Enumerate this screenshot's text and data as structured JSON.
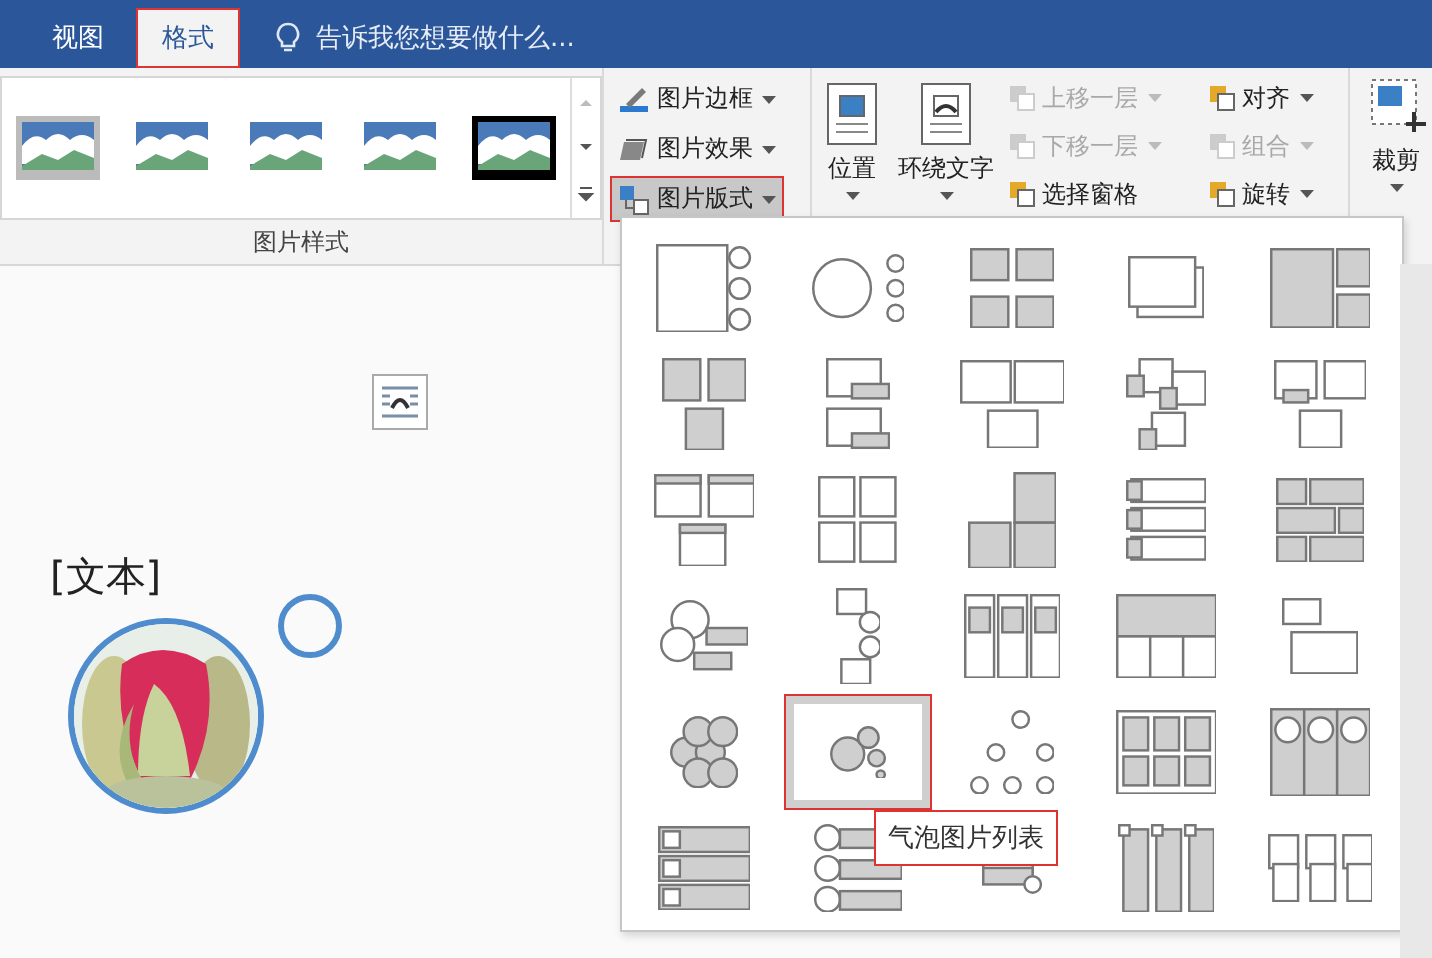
{
  "tabs": [
    {
      "label": "视图",
      "selected": false
    },
    {
      "label": "格式",
      "selected": true
    }
  ],
  "tell_me": {
    "placeholder": "告诉我您想要做什么..."
  },
  "picture_styles": {
    "label": "图片样式"
  },
  "picture_commands": [
    {
      "label": "图片边框",
      "pressed": false
    },
    {
      "label": "图片效果",
      "pressed": false
    },
    {
      "label": "图片版式",
      "pressed": true
    }
  ],
  "arrange": {
    "large": [
      {
        "label": "位置"
      },
      {
        "label": "环绕文字"
      }
    ],
    "small": [
      {
        "label": "上移一层",
        "disabled": true,
        "dropdown": true
      },
      {
        "label": "下移一层",
        "disabled": true,
        "dropdown": true
      },
      {
        "label": "选择窗格",
        "disabled": false,
        "dropdown": false
      },
      {
        "label": "对齐",
        "disabled": false,
        "dropdown": true
      },
      {
        "label": "组合",
        "disabled": true,
        "dropdown": true
      },
      {
        "label": "旋转",
        "disabled": false,
        "dropdown": true
      }
    ]
  },
  "crop": {
    "label": "裁剪"
  },
  "layout_gallery": {
    "tooltip": "气泡图片列表",
    "items": [
      {
        "selected": false
      },
      {
        "selected": false
      },
      {
        "selected": false
      },
      {
        "selected": false
      },
      {
        "selected": false
      },
      {
        "selected": false
      },
      {
        "selected": false
      },
      {
        "selected": false
      },
      {
        "selected": false
      },
      {
        "selected": false
      },
      {
        "selected": false
      },
      {
        "selected": false
      },
      {
        "selected": false
      },
      {
        "selected": false
      },
      {
        "selected": false
      },
      {
        "selected": false
      },
      {
        "selected": false
      },
      {
        "selected": false
      },
      {
        "selected": false
      },
      {
        "selected": false
      },
      {
        "selected": false
      },
      {
        "selected": true
      },
      {
        "selected": false
      },
      {
        "selected": false
      },
      {
        "selected": false
      },
      {
        "selected": false
      },
      {
        "selected": false
      },
      {
        "selected": false
      },
      {
        "selected": false
      },
      {
        "selected": false
      }
    ]
  },
  "document": {
    "text": "[文本]"
  }
}
